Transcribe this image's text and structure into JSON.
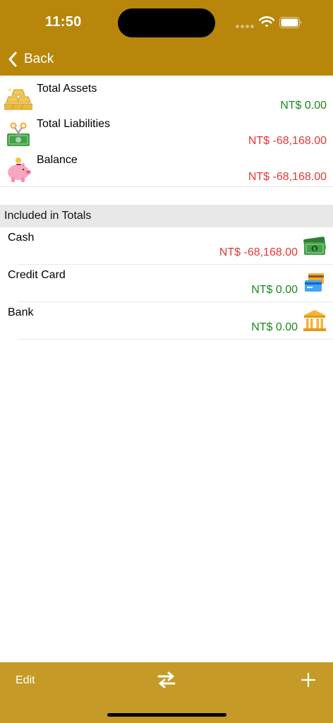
{
  "status_bar": {
    "time": "11:50"
  },
  "nav": {
    "back_label": "Back"
  },
  "summary": [
    {
      "title": "Total Assets",
      "value": "NT$ 0.00",
      "icon": "gold-bars-icon",
      "tone": "green"
    },
    {
      "title": "Total Liabilities",
      "value": "NT$ -68,168.00",
      "icon": "cut-money-icon",
      "tone": "red"
    },
    {
      "title": "Balance",
      "value": "NT$ -68,168.00",
      "icon": "piggy-bank-icon",
      "tone": "red"
    }
  ],
  "section": {
    "title": "Included in Totals"
  },
  "accounts": [
    {
      "name": "Cash",
      "value": "NT$ -68,168.00",
      "icon": "cash-icon",
      "tone": "red"
    },
    {
      "name": "Credit Card",
      "value": "NT$ 0.00",
      "icon": "credit-card-icon",
      "tone": "green"
    },
    {
      "name": "Bank",
      "value": "NT$ 0.00",
      "icon": "bank-icon",
      "tone": "green"
    }
  ],
  "toolbar": {
    "edit_label": "Edit",
    "transfer_icon": "transfer-icon",
    "add_icon": "add-icon"
  },
  "colors": {
    "header": "#B8860B",
    "toolbar": "#C59A27",
    "positive": "#1a8a1a",
    "negative": "#e53935"
  }
}
